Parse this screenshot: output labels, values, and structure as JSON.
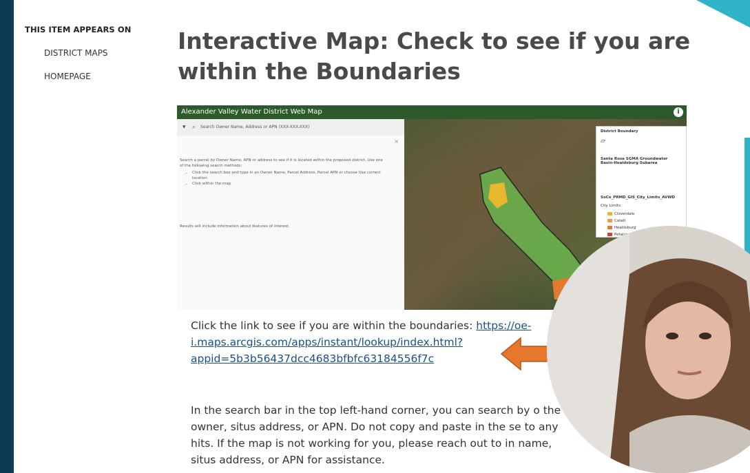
{
  "sidebar": {
    "heading": "THIS ITEM APPEARS ON",
    "links": [
      "DISTRICT MAPS",
      "HOMEPAGE"
    ]
  },
  "title": "Interactive Map: Check to see if you are within the Boundaries",
  "map": {
    "header_title": "Alexander Valley Water District Web Map",
    "search_placeholder": "Search Owner Name, Address or APN (XXX-XXX-XXX)",
    "intro": "Search a parcel by Owner Name, APN or address to see if it is located within the proposed district. Use one of the following search methods:",
    "methods": [
      "Click the search box and type in an Owner Name, Parcel Address, Parcel APN or choose Use current location",
      "Click within the map"
    ],
    "results_note": "Results will include information about features of interest.",
    "legend": {
      "district_boundary": "District Boundary",
      "basin": "Santa Rosa SGMA Groundwater Basin-Healdsburg Subarea",
      "city_limits_layer": "SoCo_PRMD_GIS_City_Limits_AVWD",
      "city_limits_label": "City Limits",
      "cities": [
        "Cloverdale",
        "Cotati",
        "Healdsburg",
        "Petaluma"
      ]
    },
    "colors": {
      "header": "#2d5a2a",
      "district_fill": "#6ab04c",
      "city_yellow": "#e8b730",
      "city_orange": "#e07a2e",
      "city_red": "#d04040"
    }
  },
  "para1": {
    "text": "Click the link to see if you are within the boundaries: ",
    "link": "https://oe-i.maps.arcgis.com/apps/instant/lookup/index.html?appid=5b3b56437dcc4683bfbfc63184556f7c"
  },
  "para2": "In the search bar in the top left-hand corner, you can search by o the owner, situs address, or APN.  Do not copy and paste in the se to any hits. If the map is not working for you, please reach out to in name, situs address, or APN for assistance.",
  "arrow_color": "#e8772e"
}
